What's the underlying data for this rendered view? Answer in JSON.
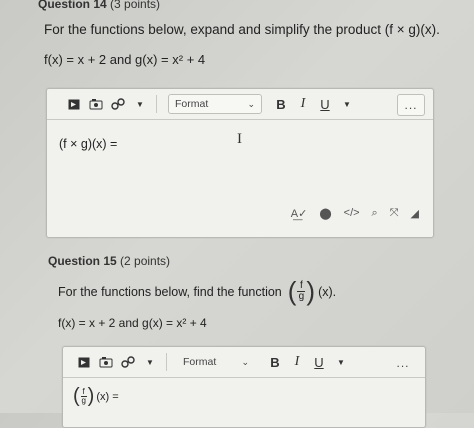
{
  "q14": {
    "title_prefix": "Question 14",
    "title_points": "(3 points)",
    "prompt": "For the functions below, expand and simplify the product (f × g)(x).",
    "functions": "f(x) = x + 2 and g(x) = x² + 4",
    "toolbar": {
      "format_label": "Format",
      "bold": "B",
      "italic": "I",
      "underline": "U",
      "more": "..."
    },
    "answer_text": "(f × g)(x) =",
    "cursor_glyph": "I"
  },
  "q15": {
    "title_prefix": "Question 15",
    "title_points": "(2 points)",
    "prompt_before": "For the functions below, find the function",
    "frac_num": "f",
    "frac_den": "g",
    "prompt_after": "(x).",
    "functions": "f(x) = x + 2 and g(x) = x² + 4",
    "toolbar": {
      "format_label": "Format",
      "bold": "B",
      "italic": "I",
      "underline": "U",
      "more": "..."
    },
    "answer_suffix": "(x) ="
  }
}
